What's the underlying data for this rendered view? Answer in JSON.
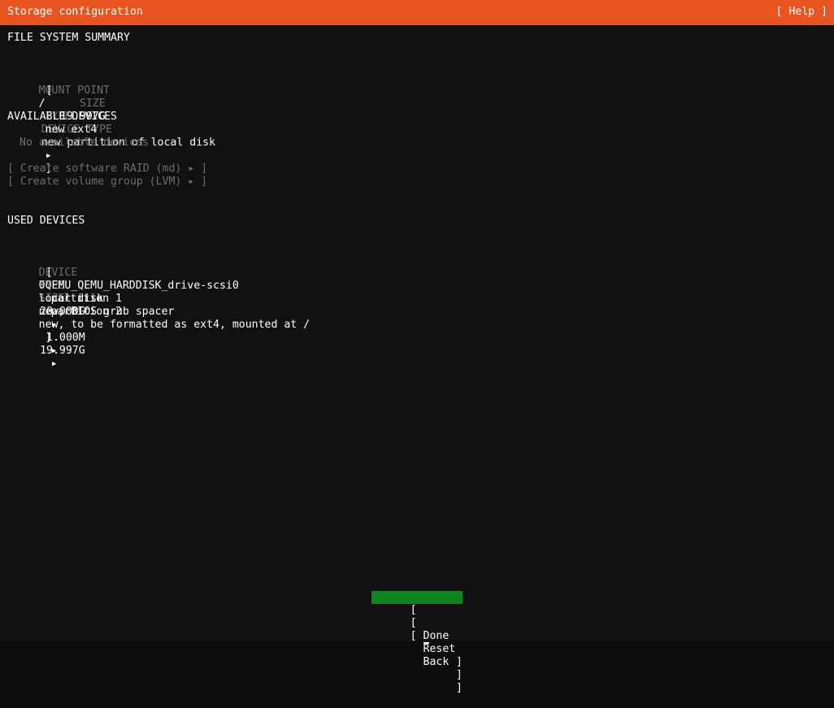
{
  "header": {
    "title": "Storage configuration",
    "help_label": "[ Help ]"
  },
  "colors": {
    "header_bg": "#e95420",
    "screen_bg": "#111111",
    "text": "#ffffff",
    "dim_text": "#6e6e6e",
    "selected_bg": "#0e8420"
  },
  "filesystem_summary": {
    "section_title": "FILE SYSTEM SUMMARY",
    "columns": {
      "mount_point": "MOUNT POINT",
      "size": "SIZE",
      "type": "TYPE",
      "device_type": "DEVICE TYPE"
    },
    "rows": [
      {
        "open_bracket": "[",
        "mount_point": "/",
        "size": "19.997G",
        "type": "new ext4",
        "device_type": "new partition of local disk",
        "arrow": "▸",
        "close_bracket": "]"
      }
    ]
  },
  "available_devices": {
    "section_title": "AVAILABLE DEVICES",
    "empty_message": "No available devices",
    "actions": [
      {
        "label": "[ Create software RAID (md) ▸ ]"
      },
      {
        "label": "[ Create volume group (LVM) ▸ ]"
      }
    ]
  },
  "used_devices": {
    "section_title": "USED DEVICES",
    "columns": {
      "device": "DEVICE",
      "type": "TYPE",
      "size": "SIZE"
    },
    "rows": [
      {
        "open_bracket": "[",
        "device": "0QEMU_QEMU_HARDDISK_drive-scsi0",
        "type": "local disk",
        "size": "20.000G",
        "arrow": "▸",
        "close_bracket": "]"
      },
      {
        "open_bracket": "",
        "device": "partition 1",
        "detail": "new, BIOS grub spacer",
        "type": "",
        "size": "1.000M",
        "arrow": "▸",
        "close_bracket": ""
      },
      {
        "open_bracket": "",
        "device": "partition 2",
        "detail": "new, to be formatted as ext4, mounted at /",
        "type": "",
        "size": "19.997G",
        "arrow": "▸",
        "close_bracket": ""
      }
    ]
  },
  "footer_buttons": [
    {
      "name": "done",
      "open": "[",
      "label": "Done",
      "hot": "D",
      "rest": "one",
      "close": "]",
      "selected": true
    },
    {
      "name": "reset",
      "open": "[",
      "label": "Reset",
      "hot": "R",
      "rest": "eset",
      "close": "]",
      "selected": false
    },
    {
      "name": "back",
      "open": "[",
      "label": "Back",
      "hot": "B",
      "rest": "ack",
      "close": "]",
      "selected": false
    }
  ]
}
